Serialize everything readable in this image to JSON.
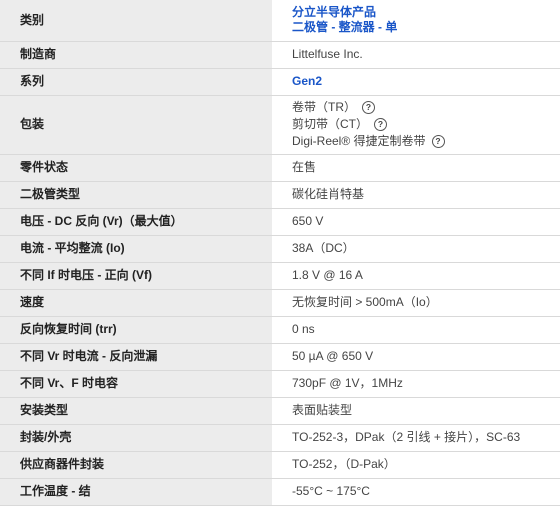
{
  "rows": [
    {
      "label": "类别",
      "lines": [
        "分立半导体产品",
        "二极管 - 整流器 - 单"
      ]
    },
    {
      "label": "制造商",
      "value": "Littelfuse Inc."
    },
    {
      "label": "系列",
      "value": "Gen2"
    },
    {
      "label": "包装",
      "lines": [
        "卷带（TR）",
        "剪切带（CT）",
        "Digi-Reel® 得捷定制卷带"
      ],
      "help_icon": "question-circle-icon"
    },
    {
      "label": "零件状态",
      "value": "在售"
    },
    {
      "label": "二极管类型",
      "value": "碳化硅肖特基"
    },
    {
      "label": "电压 - DC 反向 (Vr)（最大值）",
      "value": "650 V"
    },
    {
      "label": "电流 - 平均整流 (Io)",
      "value": "38A（DC）"
    },
    {
      "label": "不同 If 时电压 - 正向 (Vf)",
      "value": "1.8 V @ 16 A"
    },
    {
      "label": "速度",
      "value": "无恢复时间 > 500mA（Io）"
    },
    {
      "label": "反向恢复时间 (trr)",
      "value": "0 ns"
    },
    {
      "label": "不同 Vr 时电流 - 反向泄漏",
      "value": "50 µA @ 650 V"
    },
    {
      "label": "不同 Vr、F 时电容",
      "value": "730pF @ 1V，1MHz"
    },
    {
      "label": "安装类型",
      "value": "表面贴装型"
    },
    {
      "label": "封装/外壳",
      "value": "TO-252-3，DPak（2 引线 + 接片），SC-63"
    },
    {
      "label": "供应商器件封装",
      "value": "TO-252，（D-Pak）"
    },
    {
      "label": "工作温度 - 结",
      "value": "-55°C ~ 175°C"
    }
  ],
  "colors": {
    "link": "#1a56c8",
    "label_bg": "#ececec",
    "border": "#d9d9d9"
  }
}
